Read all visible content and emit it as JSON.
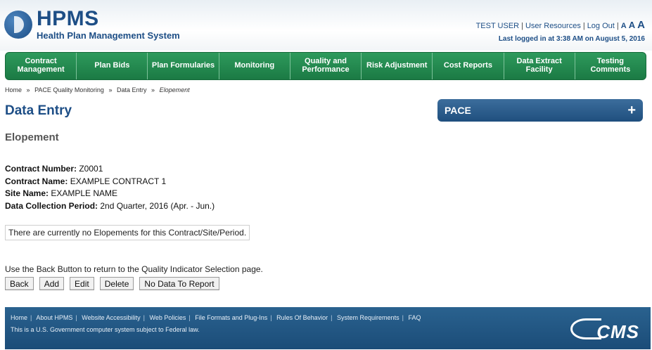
{
  "header": {
    "logo_title": "HPMS",
    "logo_subtitle": "Health Plan Management System",
    "user": "TEST USER",
    "user_resources": "User Resources",
    "logout": "Log Out",
    "font_small": "A",
    "font_medium": "A",
    "font_large": "A",
    "last_logged": "Last logged in at 3:38 AM on August 5, 2016"
  },
  "nav": {
    "items": [
      {
        "line1": "Contract",
        "line2": "Management"
      },
      {
        "line1": "Plan Bids",
        "line2": ""
      },
      {
        "line1": "Plan Formularies",
        "line2": ""
      },
      {
        "line1": "Monitoring",
        "line2": ""
      },
      {
        "line1": "Quality and",
        "line2": "Performance"
      },
      {
        "line1": "Risk Adjustment",
        "line2": ""
      },
      {
        "line1": "Cost Reports",
        "line2": ""
      },
      {
        "line1": "Data Extract",
        "line2": "Facility"
      },
      {
        "line1": "Testing",
        "line2": "Comments"
      }
    ]
  },
  "breadcrumb": {
    "home": "Home",
    "sep": "»",
    "level1": "PACE Quality Monitoring",
    "level2": "Data Entry",
    "current": "Elopement"
  },
  "page": {
    "title": "Data Entry",
    "subtitle": "Elopement"
  },
  "pace_panel": {
    "title": "PACE",
    "expand": "+"
  },
  "info": {
    "contract_number_label": "Contract Number:",
    "contract_number": " Z0001",
    "contract_name_label": "Contract Name:",
    "contract_name": " EXAMPLE CONTRACT 1",
    "site_name_label": "Site Name:",
    "site_name": " EXAMPLE NAME",
    "period_label": "Data Collection Period:",
    "period": " 2nd Quarter, 2016 (Apr. - Jun.)"
  },
  "notice": "There are currently no Elopements for this Contract/Site/Period.",
  "back_instruction": "Use the Back Button to return to the Quality Indicator Selection page.",
  "buttons": {
    "back": "Back",
    "add": "Add",
    "edit": "Edit",
    "delete": "Delete",
    "no_data": "No Data To Report"
  },
  "footer": {
    "links": [
      "Home",
      "About HPMS",
      "Website Accessibility",
      "Web Policies",
      "File Formats and Plug-Ins",
      "Rules Of Behavior",
      "System Requirements",
      "FAQ"
    ],
    "note": "This is a U.S. Government computer system subject to Federal law.",
    "logo": "CMS"
  }
}
